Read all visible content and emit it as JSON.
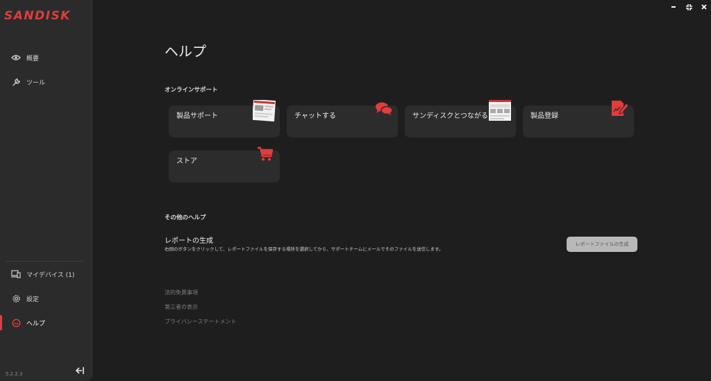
{
  "app": {
    "logo_text": "SANDISK",
    "version": "5.2.2.3",
    "accent": "#e23c3c"
  },
  "window_controls": {
    "minimize_icon": "minimize-icon",
    "maximize_icon": "maximize-icon",
    "close_icon": "close-icon"
  },
  "sidebar": {
    "top_items": [
      {
        "label": "概要",
        "icon": "eye-icon"
      },
      {
        "label": "ツール",
        "icon": "wrench-icon"
      }
    ],
    "bottom_items": [
      {
        "label": "マイデバイス (1)",
        "icon": "devices-icon"
      },
      {
        "label": "設定",
        "icon": "gear-icon"
      },
      {
        "label": "ヘルプ",
        "icon": "help-icon",
        "active": true
      }
    ]
  },
  "main": {
    "title": "ヘルプ",
    "online_support": {
      "heading": "オンラインサポート",
      "cards": [
        {
          "label": "製品サポート",
          "icon": "webpage-thumbnail-icon"
        },
        {
          "label": "チャットする",
          "icon": "chat-bubbles-icon"
        },
        {
          "label": "サンディスクとつながる",
          "icon": "community-thumbnail-icon"
        },
        {
          "label": "製品登録",
          "icon": "register-document-icon"
        },
        {
          "label": "ストア",
          "icon": "cart-icon"
        }
      ]
    },
    "other_help": {
      "heading": "その他のヘルプ",
      "report_title": "レポートの生成",
      "report_desc": "右側のボタンをクリックして、レポートファイルを保存する場所を選択してから、サポートチームにメールでそのファイルを送信します。",
      "report_button": "レポートファイルの生成"
    },
    "footer_links": [
      "法的免責事項",
      "第三者の表示",
      "プライバシーステートメント"
    ]
  }
}
